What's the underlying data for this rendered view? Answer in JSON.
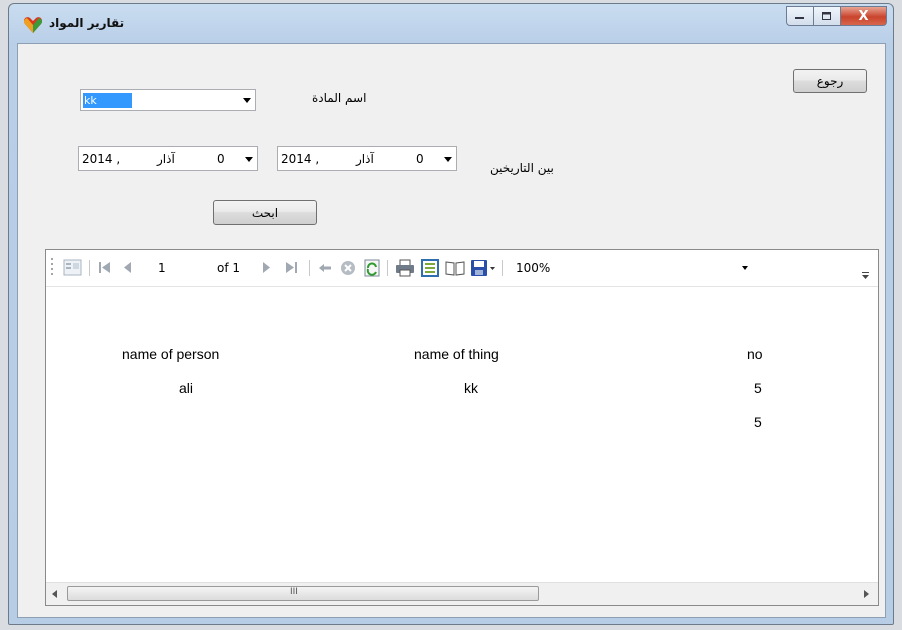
{
  "window": {
    "title": "تقارير المواد",
    "close_label": "X"
  },
  "form": {
    "material_label": "اسم المادة",
    "material_value": "kk",
    "between_dates_label": "بين التاريخين",
    "date_from": {
      "day": "0",
      "month": "آذار",
      "year": "2014 ,"
    },
    "date_to": {
      "day": "0",
      "month": "آذار",
      "year": "2014 ,"
    },
    "back_button": "رجوع",
    "search_button": "ابحث"
  },
  "report_toolbar": {
    "page": "1",
    "page_of": "of 1",
    "zoom": "100%"
  },
  "report": {
    "columns": [
      "name of person",
      "name of thing",
      "no"
    ],
    "rows": [
      [
        "ali",
        "kk",
        "5"
      ],
      [
        "",
        "",
        "5"
      ]
    ]
  },
  "scrollbar": {
    "thumb_grip": "III"
  }
}
